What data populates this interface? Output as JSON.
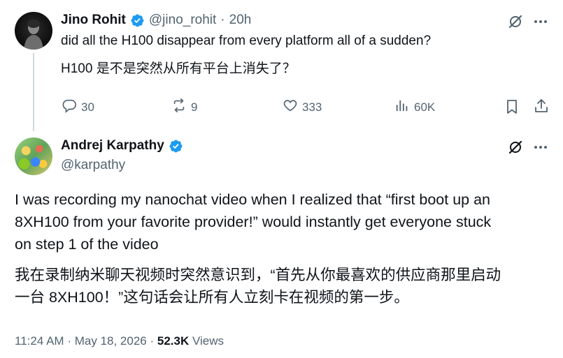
{
  "reply_to": {
    "author_name": "Jino Rohit",
    "handle": "@jino_rohit",
    "separator": "·",
    "time": "20h",
    "text_en": "did all the H100 disappear from every platform all of a sudden?",
    "text_zh": "H100 是不是突然从所有平台上消失了？",
    "stats": {
      "replies": "30",
      "reposts": "9",
      "likes": "333",
      "views": "60K"
    }
  },
  "tweet": {
    "author_name": "Andrej Karpathy",
    "handle": "@karpathy",
    "text_en_lines": [
      "I was recording my nanochat video when I realized that “first boot up an",
      "8XH100 from your favorite provider!” would instantly get everyone stuck",
      "on step 1 of the video"
    ],
    "text_zh_lines": [
      "我在录制纳米聊天视频时突然意识到，“首先从你最喜欢的供应商那里启动",
      "一台 8XH100！”这句话会让所有人立刻卡在视频的第一步。"
    ],
    "time": "11:24 AM",
    "date": "May 18, 2026",
    "dot": "·",
    "views_count": "52.3K",
    "views_label": "Views"
  },
  "icons": {
    "verified": "verified-badge-icon",
    "grok": "grok-icon",
    "more": "more-icon",
    "reply": "reply-icon",
    "repost": "repost-icon",
    "like": "like-icon",
    "views": "views-icon",
    "bookmark": "bookmark-icon",
    "share": "share-icon"
  },
  "colors": {
    "verified": "#1d9bf0",
    "text": "#0f1419",
    "muted": "#536471",
    "thread_line": "#cfd9de"
  }
}
